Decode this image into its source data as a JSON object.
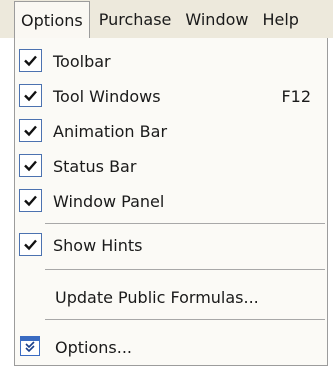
{
  "menubar": {
    "items": [
      "Options",
      "Purchase",
      "Window",
      "Help"
    ]
  },
  "menu": {
    "items": [
      {
        "label": "Toolbar",
        "checked": true,
        "shortcut": ""
      },
      {
        "label": "Tool Windows",
        "checked": true,
        "shortcut": "F12"
      },
      {
        "label": "Animation Bar",
        "checked": true,
        "shortcut": ""
      },
      {
        "label": "Status Bar",
        "checked": true,
        "shortcut": ""
      },
      {
        "label": "Window Panel",
        "checked": true,
        "shortcut": ""
      },
      {
        "label": "Show Hints",
        "checked": true,
        "shortcut": ""
      },
      {
        "label": "Update Public Formulas...",
        "checked": false,
        "shortcut": ""
      },
      {
        "label": "Options...",
        "checked": false,
        "shortcut": "",
        "icon": "options-window-icon"
      }
    ]
  },
  "colors": {
    "menubar_bg": "#ede9dc",
    "menu_bg": "#fbfaf6",
    "check_border": "#4c72b0",
    "separator": "#a8a8a8"
  }
}
